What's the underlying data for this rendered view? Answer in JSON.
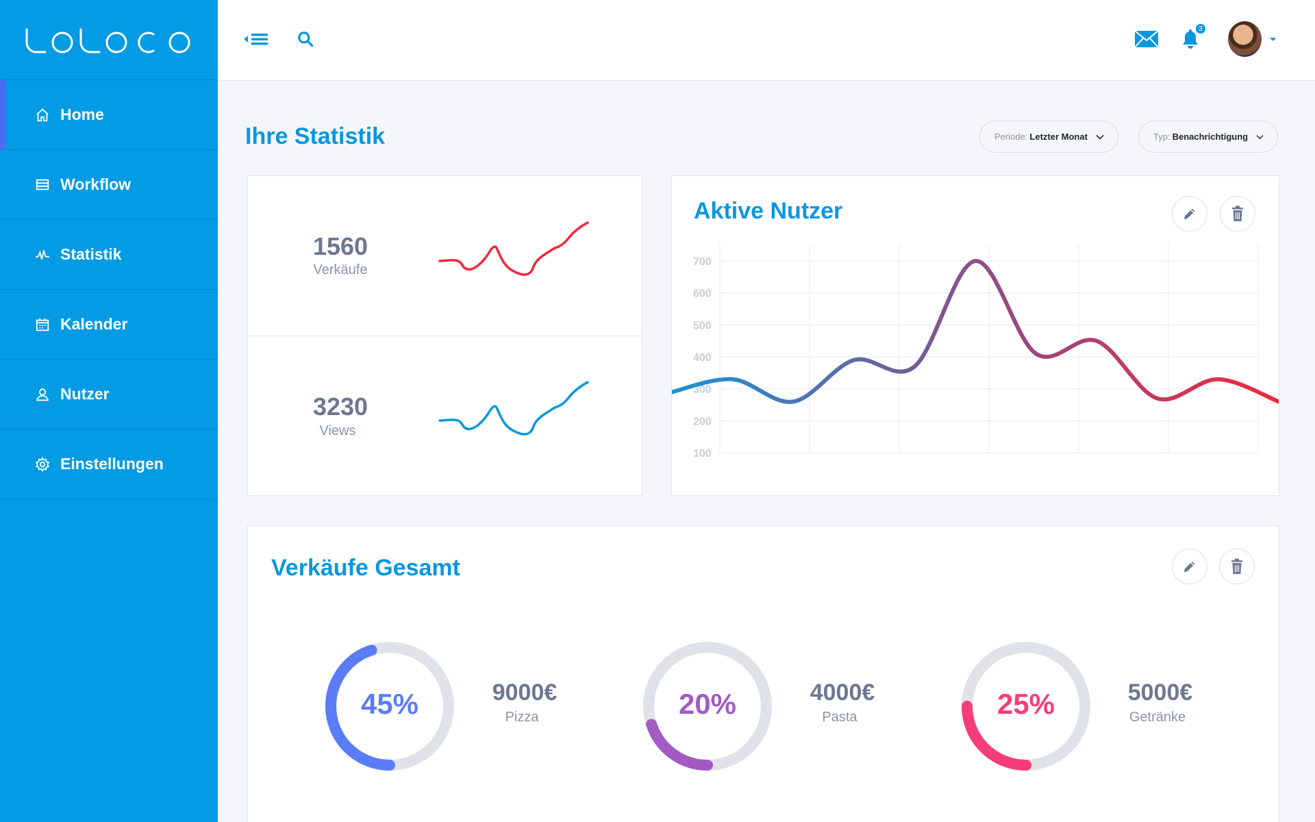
{
  "brand": {
    "logo_text": "UOLOCO"
  },
  "sidebar": {
    "items": [
      {
        "label": "Home",
        "icon": "home-icon"
      },
      {
        "label": "Workflow",
        "icon": "workflow-icon"
      },
      {
        "label": "Statistik",
        "icon": "statistik-icon"
      },
      {
        "label": "Kalender",
        "icon": "calendar-icon"
      },
      {
        "label": "Nutzer",
        "icon": "user-icon"
      },
      {
        "label": "Einstellungen",
        "icon": "gear-icon"
      }
    ]
  },
  "topbar": {
    "notification_count": "3"
  },
  "page": {
    "title": "Ihre Statistik",
    "filters": [
      {
        "label": "Periode:",
        "value": "Letzter Monat"
      },
      {
        "label": "Typ:",
        "value": "Benachrichtigung"
      }
    ]
  },
  "stats": [
    {
      "value": "1560",
      "label": "Verkäufe",
      "color": "#f0283c"
    },
    {
      "value": "3230",
      "label": "Views",
      "color": "#0b97dd"
    }
  ],
  "active_users": {
    "title": "Aktive Nutzer"
  },
  "sales_total": {
    "title": "Verkäufe Gesamt",
    "items": [
      {
        "percent_label": "45%",
        "percent": 45,
        "amount": "9000€",
        "label": "Pizza",
        "color": "#5b7cf7"
      },
      {
        "percent_label": "20%",
        "percent": 20,
        "amount": "4000€",
        "label": "Pasta",
        "color": "#a25bc3"
      },
      {
        "percent_label": "25%",
        "percent": 25,
        "amount": "5000€",
        "label": "Getränke",
        "color": "#f43d79"
      }
    ]
  },
  "chart_data": {
    "type": "line",
    "title": "Aktive Nutzer",
    "y_ticks": [
      "700",
      "600",
      "500",
      "400",
      "300",
      "200",
      "100"
    ],
    "ylim": [
      100,
      700
    ],
    "grid": true,
    "x": [
      0,
      1,
      2,
      3,
      4,
      5,
      6,
      7,
      8,
      9,
      10
    ],
    "series": [
      {
        "values": [
          290,
          330,
          260,
          390,
          370,
          700,
          410,
          450,
          270,
          330,
          260
        ]
      }
    ],
    "gradient": [
      "#1b92d6",
      "#8a4f8a",
      "#f0283c"
    ]
  }
}
